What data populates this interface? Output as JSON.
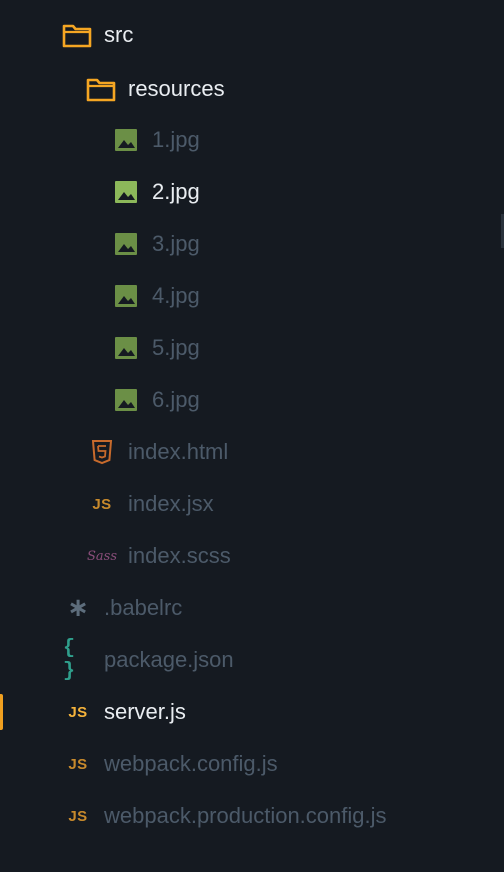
{
  "tree": {
    "items": [
      {
        "label": "src",
        "icon": "folder-icon",
        "state": "bright"
      },
      {
        "label": "resources",
        "icon": "folder-icon",
        "state": "bright"
      },
      {
        "label": "1.jpg",
        "icon": "image-icon",
        "state": "dim"
      },
      {
        "label": "2.jpg",
        "icon": "image-icon",
        "state": "bright"
      },
      {
        "label": "3.jpg",
        "icon": "image-icon",
        "state": "dim"
      },
      {
        "label": "4.jpg",
        "icon": "image-icon",
        "state": "dim"
      },
      {
        "label": "5.jpg",
        "icon": "image-icon",
        "state": "dim"
      },
      {
        "label": "6.jpg",
        "icon": "image-icon",
        "state": "dim"
      },
      {
        "label": "index.html",
        "icon": "html5-icon",
        "state": "dim"
      },
      {
        "label": "index.jsx",
        "icon": "js-icon",
        "state": "dim",
        "glyph": "JS"
      },
      {
        "label": "index.scss",
        "icon": "sass-icon",
        "state": "dim",
        "glyph": "Sass"
      },
      {
        "label": ".babelrc",
        "icon": "asterisk-icon",
        "state": "dim",
        "glyph": "∗"
      },
      {
        "label": "package.json",
        "icon": "json-braces-icon",
        "state": "dim",
        "glyph": "{ }"
      },
      {
        "label": "server.js",
        "icon": "js-icon",
        "state": "bright",
        "glyph": "JS",
        "selected": true
      },
      {
        "label": "webpack.config.js",
        "icon": "js-icon",
        "state": "dim",
        "glyph": "JS"
      },
      {
        "label": "webpack.production.config.js",
        "icon": "js-icon",
        "state": "dim",
        "glyph": "JS"
      }
    ]
  },
  "colors": {
    "background": "#151a21",
    "folder": "#f5a623",
    "image": "#6b8f46",
    "image_bright": "#8cb85a",
    "html5": "#c76a2c",
    "js": "#c88a2c",
    "json": "#2f9f8c",
    "selection_marker": "#f0a020",
    "text_dim": "#4c5a69",
    "text_bright": "#e9edf1"
  }
}
